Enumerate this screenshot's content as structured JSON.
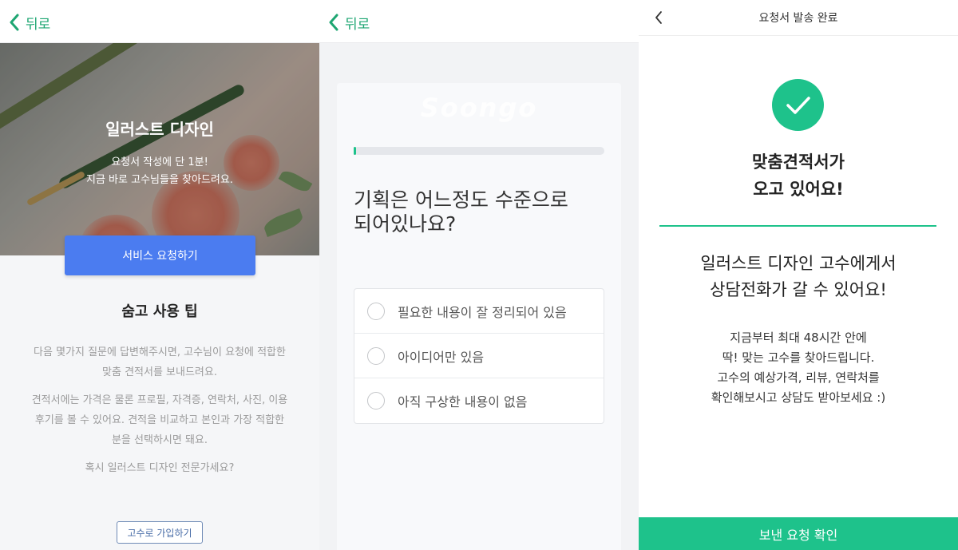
{
  "panel1": {
    "back_label": "뒤로",
    "hero_title": "일러스트 디자인",
    "hero_sub1": "요청서 작성에 단 1분!",
    "hero_sub2": "지금 바로 고수님들을 찾아드려요.",
    "request_button": "서비스 요청하기",
    "tips_title": "숨고 사용 팁",
    "tip1_line1": "다음 몇가지 질문에 답변해주시면, 고수님이 요청에 적합한",
    "tip1_line2": "맞춤 견적서를 보내드려요.",
    "tip2_line1": "견적서에는 가격은 물론 프로필, 자격증, 연락처, 사진, 이용",
    "tip2_line2": "후기를 볼 수 있어요. 견적을 비교하고 본인과 가장 적합한",
    "tip2_line3": "분을 선택하시면 돼요.",
    "tip3": "혹시 일러스트 디자인 전문가세요?",
    "join_button": "고수로 가입하기"
  },
  "panel2": {
    "back_label": "뒤로",
    "watermark": "Soongo",
    "progress": 0.01,
    "question_line1": "기획은 어느정도 수준으로",
    "question_line2": "되어있나요?",
    "options": [
      {
        "label": "필요한 내용이 잘 정리되어 있음"
      },
      {
        "label": "아이디어만 있음"
      },
      {
        "label": "아직 구상한 내용이 없음"
      }
    ]
  },
  "panel3": {
    "title": "요청서 발송 완료",
    "headline_line1": "맞춤견적서가",
    "headline_line2": "오고 있어요!",
    "sub_line1": "일러스트 디자인 고수에게서",
    "sub_line2": "상담전화가 갈 수 있어요!",
    "desc_line1": "지금부터 최대 48시간 안에",
    "desc_line2": "딱! 맞는 고수를 찾아드립니다.",
    "desc_line3": "고수의 예상가격, 리뷰, 연락처를",
    "desc_line4": "확인해보시고 상담도 받아보세요 :)",
    "confirm_button": "보낸 요청 확인"
  },
  "colors": {
    "accent_green": "#1ec28b",
    "blue_button": "#4b7cf0",
    "back_green": "#1ea672"
  },
  "icons": {
    "back": "chevron-left-icon",
    "check": "check-icon",
    "radio": "radio-unchecked-icon"
  }
}
